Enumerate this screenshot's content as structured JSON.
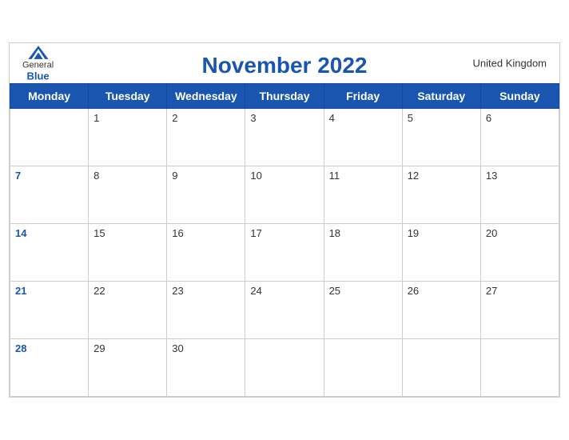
{
  "header": {
    "title": "November 2022",
    "country": "United Kingdom",
    "logo": {
      "general": "General",
      "blue": "Blue"
    }
  },
  "days": {
    "headers": [
      "Monday",
      "Tuesday",
      "Wednesday",
      "Thursday",
      "Friday",
      "Saturday",
      "Sunday"
    ]
  },
  "weeks": [
    [
      null,
      "1",
      "2",
      "3",
      "4",
      "5",
      "6"
    ],
    [
      "7",
      "8",
      "9",
      "10",
      "11",
      "12",
      "13"
    ],
    [
      "14",
      "15",
      "16",
      "17",
      "18",
      "19",
      "20"
    ],
    [
      "21",
      "22",
      "23",
      "24",
      "25",
      "26",
      "27"
    ],
    [
      "28",
      "29",
      "30",
      null,
      null,
      null,
      null
    ]
  ]
}
